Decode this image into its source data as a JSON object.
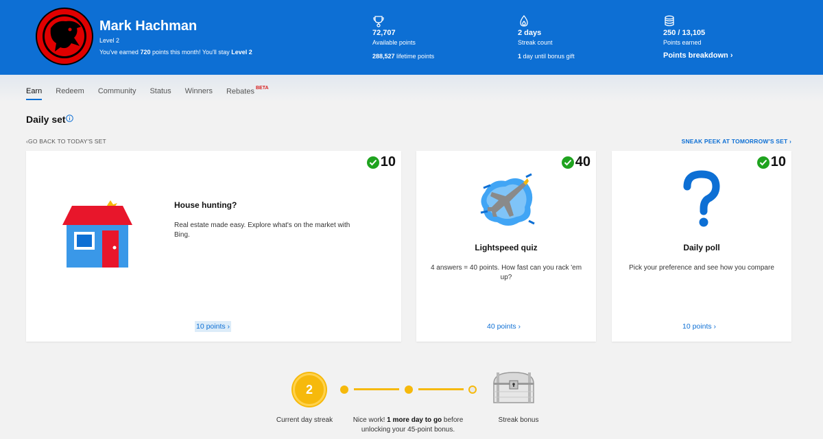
{
  "user": {
    "name": "Mark Hachman",
    "level": "Level 2",
    "month_prefix": "You've earned ",
    "month_points": "720",
    "month_middle": " points this month! You'll stay ",
    "month_level": "Level 2"
  },
  "stats": {
    "available": {
      "icon": "trophy-icon",
      "value": "72,707",
      "label": "Available points",
      "lifetime_value": "288,527",
      "lifetime_label": " lifetime points"
    },
    "streak": {
      "icon": "flame-icon",
      "value": "2 days",
      "label": "Streak count",
      "bonus_value": "1",
      "bonus_label": " day until bonus gift"
    },
    "earned": {
      "icon": "coin-stack-icon",
      "value": "250 / 13,105",
      "label": "Points earned",
      "link": "Points breakdown"
    }
  },
  "tabs": [
    {
      "label": "Earn",
      "active": true
    },
    {
      "label": "Redeem"
    },
    {
      "label": "Community"
    },
    {
      "label": "Status"
    },
    {
      "label": "Winners"
    },
    {
      "label": "Rebates",
      "badge": "BETA"
    }
  ],
  "daily_set": {
    "title": "Daily set",
    "back_label": "GO BACK TO TODAY'S SET",
    "peek_label": "SNEAK PEEK AT TOMORROW'S SET"
  },
  "cards": [
    {
      "points": "10",
      "title": "House hunting?",
      "description": "Real estate made easy. Explore what's on the market with Bing.",
      "link": "10 points",
      "icon": "house-icon"
    },
    {
      "points": "40",
      "title": "Lightspeed quiz",
      "description": "4 answers = 40 points. How fast can you rack 'em up?",
      "link": "40 points",
      "icon": "jet-icon"
    },
    {
      "points": "10",
      "title": "Daily poll",
      "description": "Pick your preference and see how you compare",
      "link": "10 points",
      "icon": "question-mark-icon"
    }
  ],
  "streak": {
    "current": "2",
    "current_label": "Current day streak",
    "msg_prefix": "Nice work! ",
    "msg_bold": "1 more day to go",
    "msg_suffix": " before unlocking your 45-point bonus.",
    "bonus_label": "Streak bonus"
  },
  "colors": {
    "header_blue": "#0d6fd4",
    "check_green": "#1fa31f",
    "streak_gold": "#f6b90c",
    "beta_red": "#d81e1e"
  }
}
